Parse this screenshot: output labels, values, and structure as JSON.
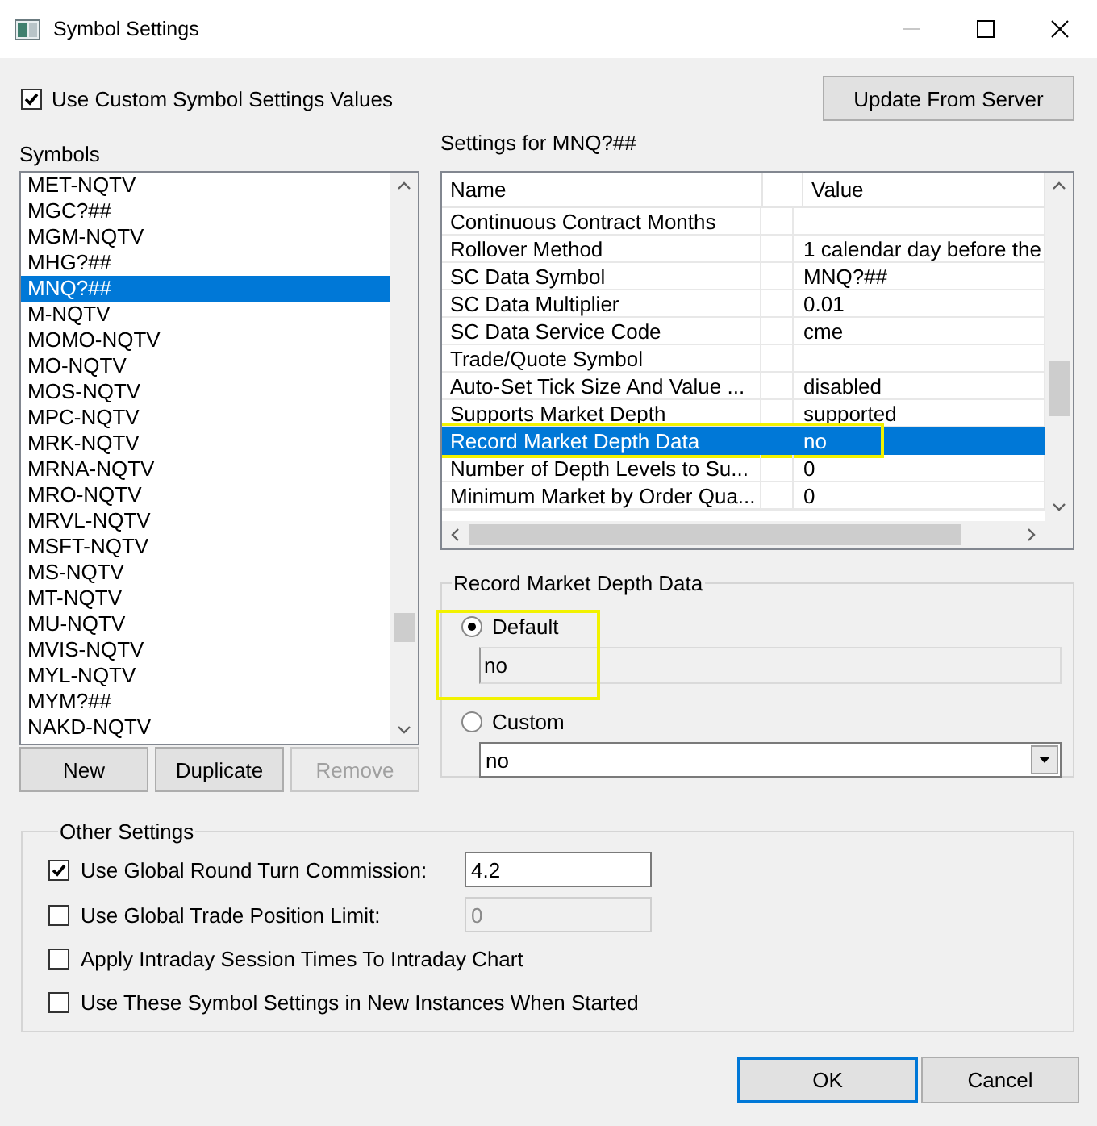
{
  "window": {
    "title": "Symbol Settings"
  },
  "use_custom": {
    "label": "Use Custom Symbol Settings Values",
    "checked": true
  },
  "update_button": "Update From Server",
  "symbols": {
    "label": "Symbols",
    "items": [
      {
        "label": "MET-NQTV",
        "selected": false
      },
      {
        "label": "MGC?##",
        "selected": false
      },
      {
        "label": "MGM-NQTV",
        "selected": false
      },
      {
        "label": "MHG?##",
        "selected": false
      },
      {
        "label": "MNQ?##",
        "selected": true
      },
      {
        "label": "M-NQTV",
        "selected": false
      },
      {
        "label": "MOMO-NQTV",
        "selected": false
      },
      {
        "label": "MO-NQTV",
        "selected": false
      },
      {
        "label": "MOS-NQTV",
        "selected": false
      },
      {
        "label": "MPC-NQTV",
        "selected": false
      },
      {
        "label": "MRK-NQTV",
        "selected": false
      },
      {
        "label": "MRNA-NQTV",
        "selected": false
      },
      {
        "label": "MRO-NQTV",
        "selected": false
      },
      {
        "label": "MRVL-NQTV",
        "selected": false
      },
      {
        "label": "MSFT-NQTV",
        "selected": false
      },
      {
        "label": "MS-NQTV",
        "selected": false
      },
      {
        "label": "MT-NQTV",
        "selected": false
      },
      {
        "label": "MU-NQTV",
        "selected": false
      },
      {
        "label": "MVIS-NQTV",
        "selected": false
      },
      {
        "label": "MYL-NQTV",
        "selected": false
      },
      {
        "label": "MYM?##",
        "selected": false
      },
      {
        "label": "NAKD-NQTV",
        "selected": false
      }
    ],
    "buttons": [
      {
        "label": "New",
        "disabled": false
      },
      {
        "label": "Duplicate",
        "disabled": false
      },
      {
        "label": "Remove",
        "disabled": true
      }
    ]
  },
  "settings": {
    "title": "Settings for MNQ?##",
    "columns": [
      "Name",
      "Value"
    ],
    "rows": [
      {
        "name": "Continuous Contract Months",
        "selected": false,
        "highlighted": false
      },
      {
        "name": "Rollover Method",
        "value": "1 calendar day before the",
        "selected": false,
        "highlighted": false
      },
      {
        "name": "SC Data Symbol",
        "value": "MNQ?##",
        "selected": false,
        "highlighted": false
      },
      {
        "name": "SC Data Multiplier",
        "value": "0.01",
        "selected": false,
        "highlighted": false
      },
      {
        "name": "SC Data Service Code",
        "value": "cme",
        "selected": false,
        "highlighted": false
      },
      {
        "name": "Trade/Quote Symbol",
        "selected": false,
        "highlighted": false
      },
      {
        "name": "Auto-Set Tick Size And Value ...",
        "value": "disabled",
        "selected": false,
        "highlighted": false
      },
      {
        "name": "Supports Market Depth",
        "value": "supported",
        "selected": false,
        "highlighted": false
      },
      {
        "name": "Record Market Depth Data",
        "value": "no",
        "selected": true,
        "highlighted": true
      },
      {
        "name": "Number of Depth Levels to Su...",
        "value": "0",
        "selected": false,
        "highlighted": false
      },
      {
        "name": "Minimum Market by Order Qua...",
        "value": "0",
        "selected": false,
        "highlighted": false
      }
    ]
  },
  "detail": {
    "title": "Record Market Depth Data",
    "options": [
      {
        "label": "Default",
        "selected": true,
        "highlighted": true,
        "kind": "readonly",
        "value": "no"
      },
      {
        "label": "Custom",
        "selected": false,
        "highlighted": false,
        "kind": "dropdown",
        "value": "no"
      }
    ]
  },
  "other": {
    "title": "Other Settings",
    "items": [
      {
        "label": "Use Global Round Turn Commission:",
        "checked": true,
        "kind": "field",
        "value": "4.2",
        "disabled": false
      },
      {
        "label": "Use Global Trade Position Limit:",
        "checked": false,
        "kind": "field",
        "value": "0",
        "disabled": true
      },
      {
        "label": "Apply Intraday Session Times To Intraday Chart",
        "checked": false,
        "kind": "check"
      },
      {
        "label": "Use These Symbol Settings in New Instances When Started",
        "checked": false,
        "kind": "check"
      }
    ]
  },
  "buttons": [
    "OK",
    "Cancel"
  ]
}
